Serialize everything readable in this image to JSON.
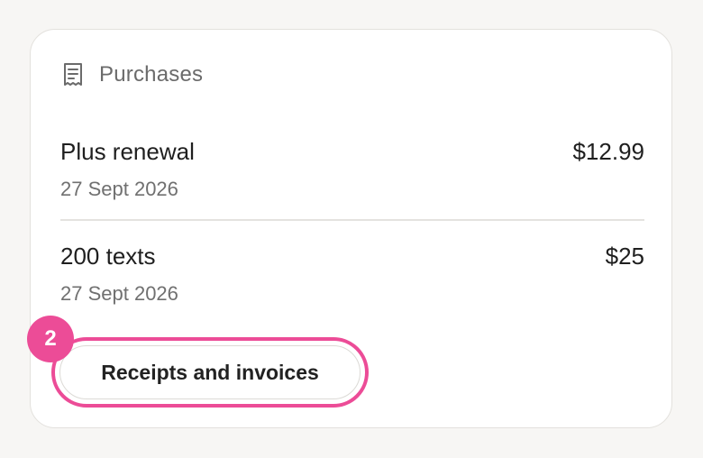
{
  "purchases": {
    "title": "Purchases",
    "icon": "receipt-icon",
    "items": [
      {
        "name": "Plus renewal",
        "date": "27 Sept 2026",
        "price": "$12.99"
      },
      {
        "name": "200 texts",
        "date": "27 Sept 2026",
        "price": "$25"
      }
    ],
    "receipts_button_label": "Receipts and invoices"
  },
  "annotation": {
    "step_number": "2",
    "color": "#ec4c97"
  }
}
